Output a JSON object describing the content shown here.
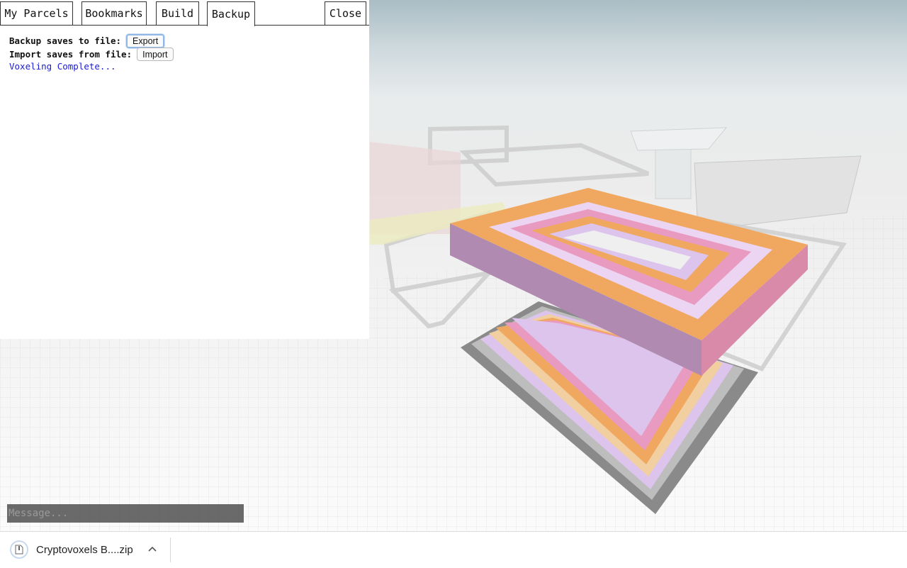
{
  "tabs": [
    {
      "label": "My Parcels"
    },
    {
      "label": "Bookmarks"
    },
    {
      "label": "Build"
    },
    {
      "label": "Backup"
    }
  ],
  "close_label": "Close",
  "backup": {
    "export_label": "Backup saves to file:",
    "export_button": "Export",
    "import_label": "Import saves from file:",
    "import_button": "Import",
    "status": "Voxeling Complete..."
  },
  "chat": {
    "placeholder": "Message..."
  },
  "download": {
    "filename": "Cryptovoxels B....zip"
  },
  "colors": {
    "status_text": "#1b1bd6",
    "accent_orange": "#f0a860",
    "accent_pink": "#e99ac0",
    "accent_lilac": "#dcc4ec"
  }
}
